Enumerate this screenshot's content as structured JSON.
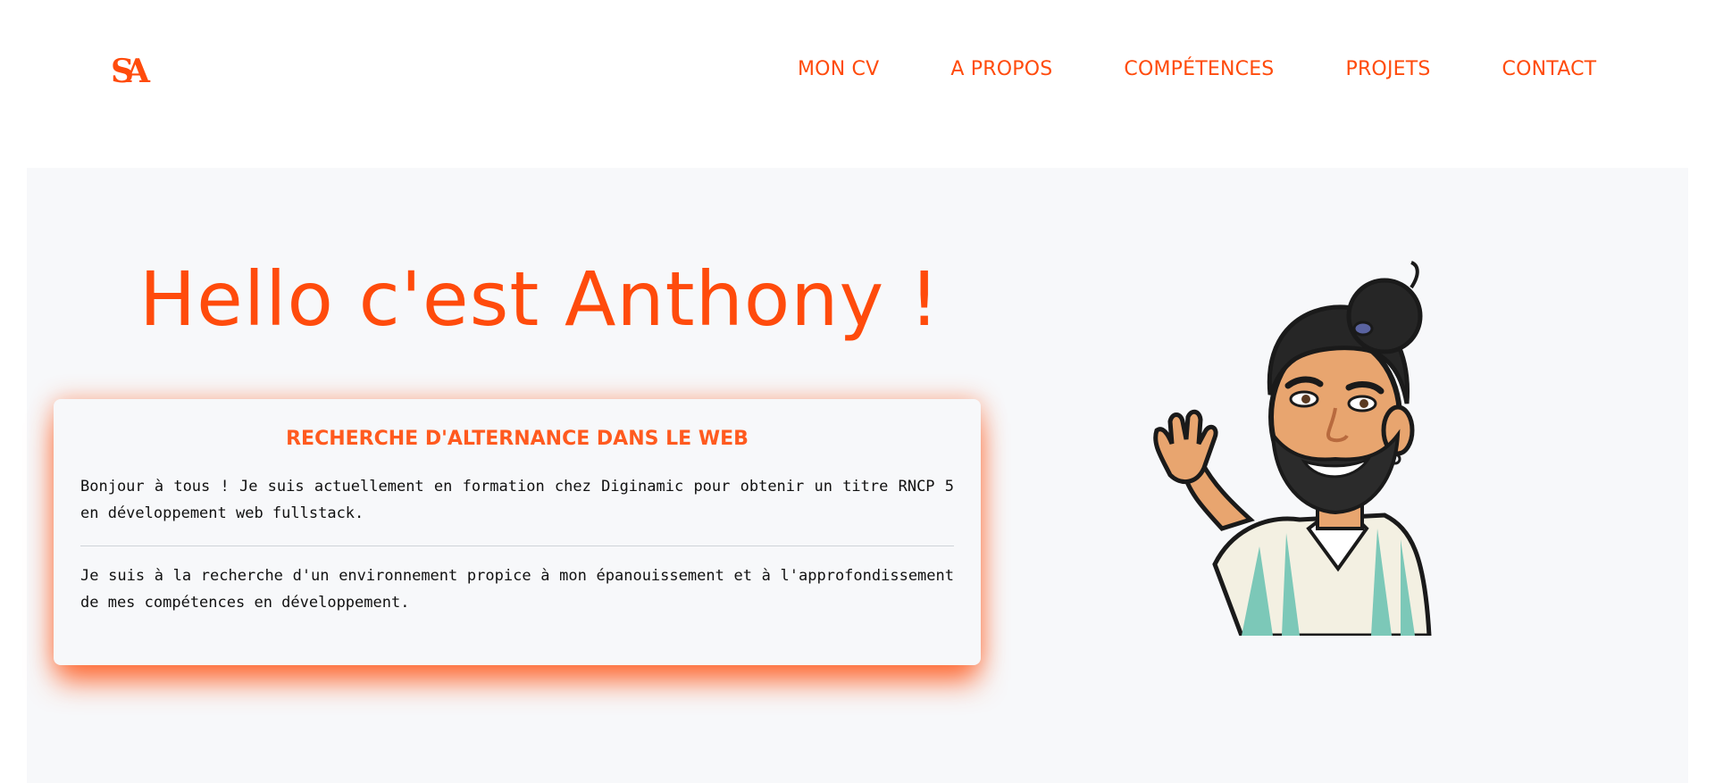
{
  "logo": {
    "text": "SA"
  },
  "nav": {
    "items": [
      {
        "label": "MON CV"
      },
      {
        "label": "A PROPOS"
      },
      {
        "label": "COMPÉTENCES"
      },
      {
        "label": "PROJETS"
      },
      {
        "label": "CONTACT"
      }
    ]
  },
  "hero": {
    "title": "Hello c'est Anthony !",
    "card": {
      "title": "RECHERCHE D'ALTERNANCE DANS LE WEB",
      "paragraph1": "Bonjour à tous ! Je suis actuellement en formation chez Diginamic pour obtenir un titre RNCP 5 en développement web fullstack.",
      "paragraph2": "Je suis à la recherche d'un environnement propice à mon épanouissement et à l'approfondissement de mes compétences en développement."
    }
  },
  "colors": {
    "accent": "#ff4b0c",
    "hero_background": "#f7f8fa",
    "card_shadow": "#ff5a1e"
  },
  "icons": {
    "logo": "sa-monogram-logo",
    "avatar": "waving-avatar-illustration"
  }
}
